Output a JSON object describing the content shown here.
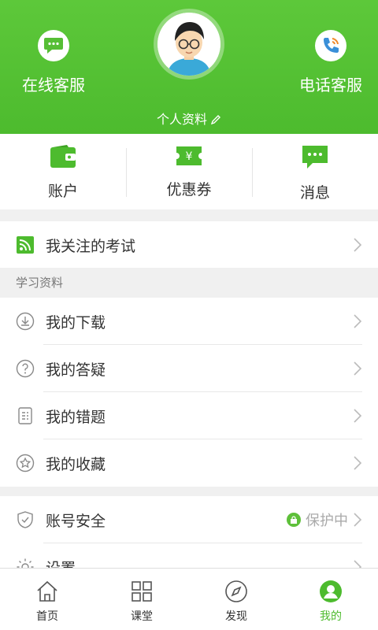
{
  "header": {
    "online_service": "在线客服",
    "phone_service": "电话客服",
    "profile_link": "个人资料"
  },
  "quick": [
    {
      "label": "账户",
      "icon": "wallet-icon"
    },
    {
      "label": "优惠券",
      "icon": "coupon-icon"
    },
    {
      "label": "消息",
      "icon": "message-icon"
    }
  ],
  "followed_exams": "我关注的考试",
  "section_study": "学习资料",
  "study_items": [
    {
      "label": "我的下载",
      "icon": "download-icon"
    },
    {
      "label": "我的答疑",
      "icon": "question-icon"
    },
    {
      "label": "我的错题",
      "icon": "wrong-questions-icon"
    },
    {
      "label": "我的收藏",
      "icon": "favorite-icon"
    }
  ],
  "account_security": {
    "label": "账号安全",
    "status": "保护中"
  },
  "settings": {
    "label": "设置"
  },
  "tabs": [
    {
      "label": "首页",
      "icon": "home-icon"
    },
    {
      "label": "课堂",
      "icon": "classroom-icon"
    },
    {
      "label": "发现",
      "icon": "compass-icon"
    },
    {
      "label": "我的",
      "icon": "profile-icon",
      "active": true
    }
  ],
  "colors": {
    "accent": "#4dbb2e",
    "header_bg": "#55c234"
  }
}
